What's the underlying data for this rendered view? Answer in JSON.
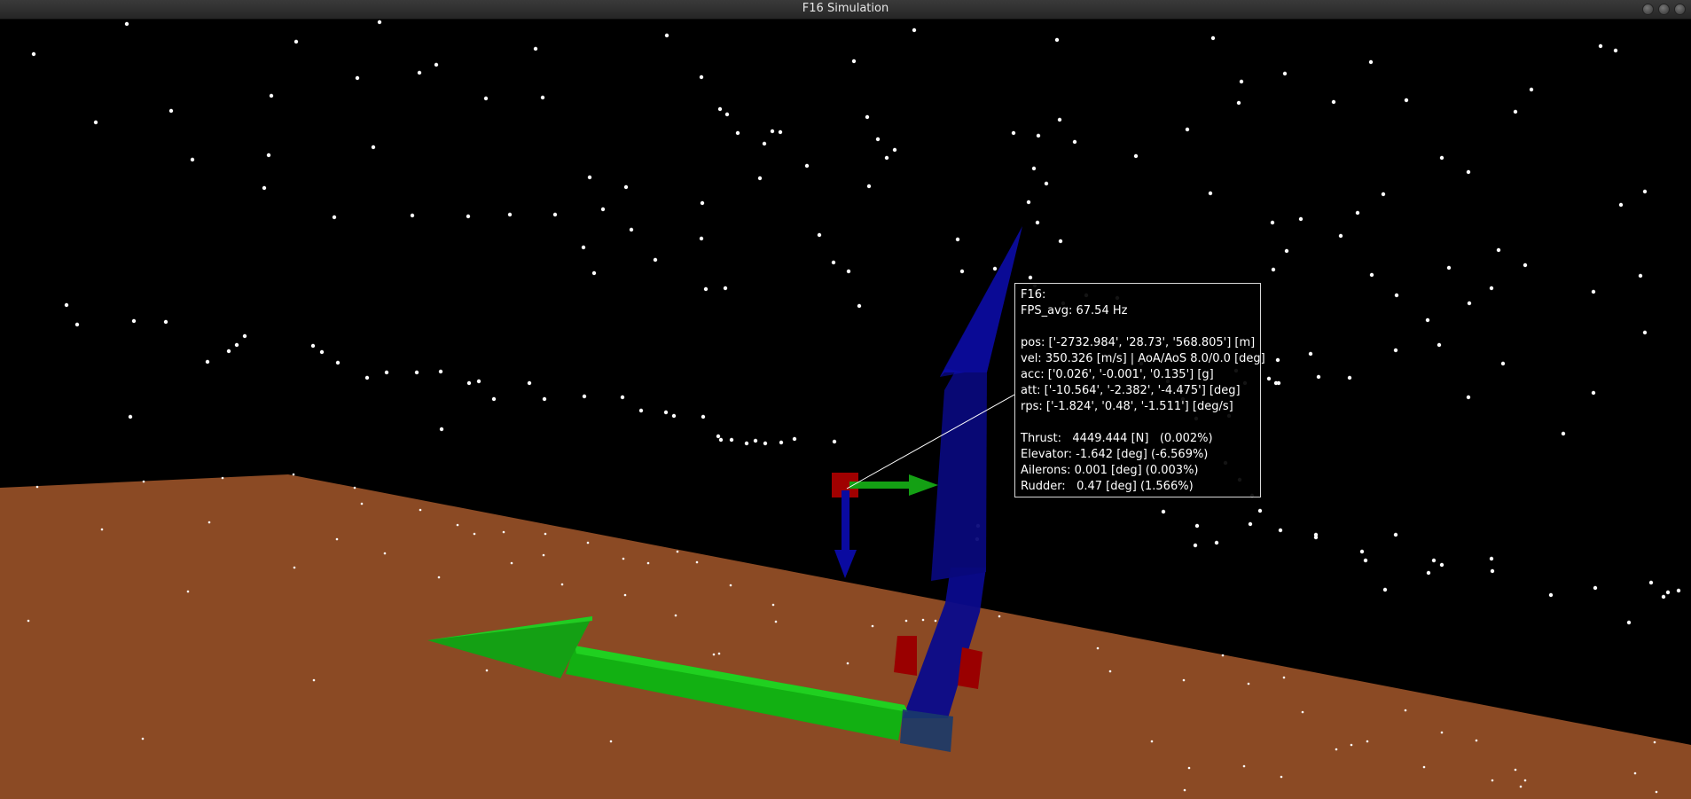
{
  "window": {
    "title": "F16 Simulation"
  },
  "colors": {
    "sky": "#000000",
    "ground": "#8b4a24",
    "star": "#ffffff",
    "x_axis": "#14b814",
    "z_axis": "#0a0a8c",
    "marker": "#a00000"
  },
  "info": {
    "name": "F16:",
    "fps": "FPS_avg: 67.54 Hz",
    "pos": "pos: ['-2732.984', '28.73', '568.805'] [m]",
    "vel": "vel: 350.326 [m/s] | AoA/AoS 8.0/0.0 [deg]",
    "acc": "acc: ['0.026', '-0.001', '0.135'] [g]",
    "att": "att: ['-10.564', '-2.382', '-4.475'] [deg]",
    "rps": "rps: ['-1.824', '0.48', '-1.511'] [deg/s]",
    "thrust": "Thrust:   4449.444 [N]   (0.002%)",
    "elevator": "Elevator: -1.642 [deg] (-6.569%)",
    "ailerons": "Ailerons: 0.001 [deg] (0.003%)",
    "rudder": "Rudder:   0.47 [deg] (1.566%)"
  }
}
